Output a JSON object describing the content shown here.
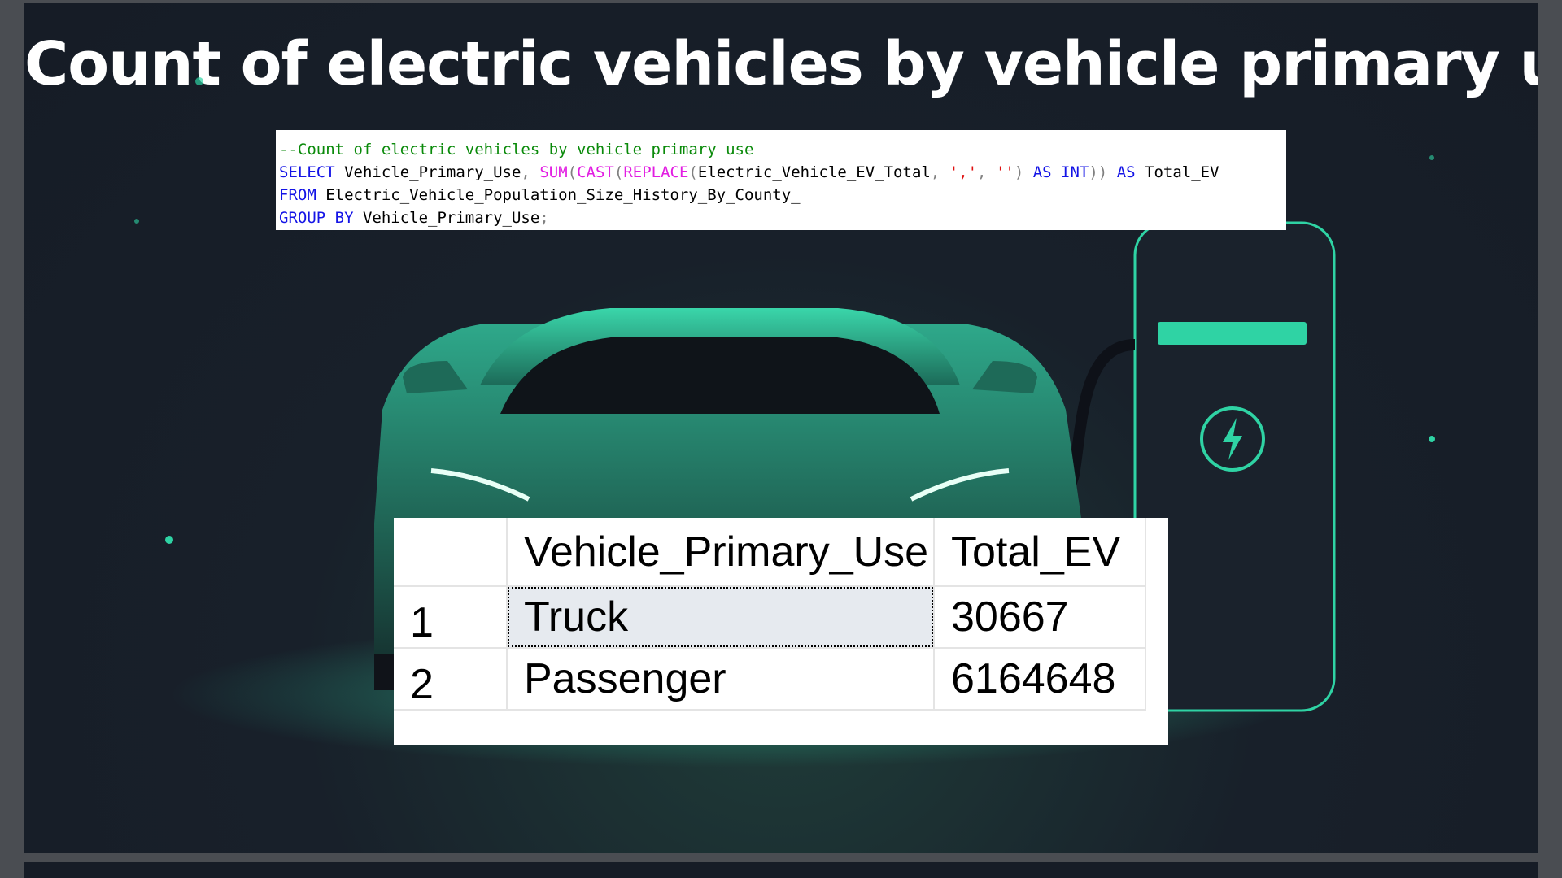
{
  "slide": {
    "title": "Count of electric vehicles by vehicle primary use"
  },
  "sql": {
    "line1": "--Count of electric vehicles by vehicle primary use",
    "line2_select": "SELECT",
    "line2_col": " Vehicle_Primary_Use",
    "line2_comma": ",",
    "line2_sum": " SUM",
    "line2_p1": "(",
    "line2_cast": "CAST",
    "line2_p2": "(",
    "line2_replace": "REPLACE",
    "line2_p3": "(",
    "line2_arg": "Electric_Vehicle_EV_Total",
    "line2_c2": ",",
    "line2_s1": " ','",
    "line2_c3": ",",
    "line2_s2": " ''",
    "line2_p4": ")",
    "line2_as1": " AS INT",
    "line2_p5": "))",
    "line2_as2": " AS",
    "line2_alias": " Total_EV",
    "line3_from": "FROM",
    "line3_table": " Electric_Vehicle_Population_Size_History_By_County_",
    "line4_group": "GROUP BY",
    "line4_col": " Vehicle_Primary_Use",
    "line4_semi": ";"
  },
  "results": {
    "columns": [
      "",
      "Vehicle_Primary_Use",
      "Total_EV"
    ],
    "rows": [
      {
        "num": "1",
        "use": "Truck",
        "total": "30667"
      },
      {
        "num": "2",
        "use": "Passenger",
        "total": "6164648"
      }
    ]
  },
  "icons": {
    "charger": "lightning-bolt-icon"
  },
  "colors": {
    "accent": "#2fd3a4",
    "background": "#161c26"
  }
}
